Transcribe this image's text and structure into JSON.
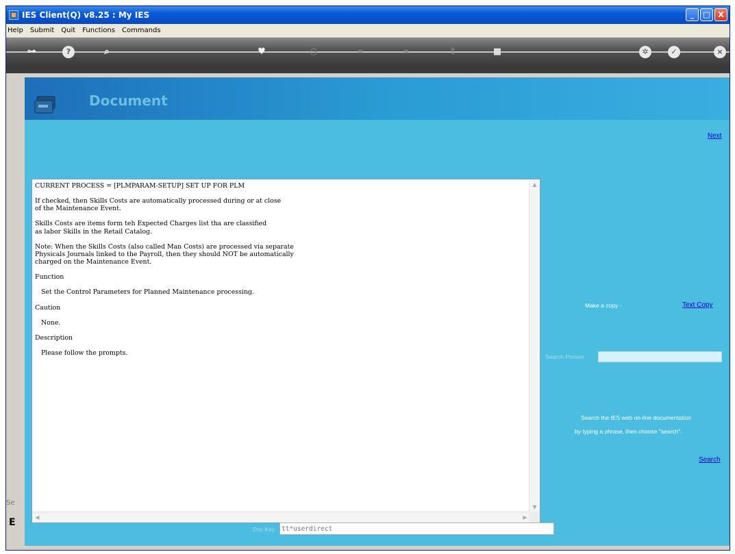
{
  "window": {
    "title": "IES Client(Q) v8.25 : My IES",
    "controls": [
      "_",
      "□",
      "X"
    ]
  },
  "menu": {
    "items": [
      "Help",
      "Submit",
      "Quit",
      "Functions",
      "Commands"
    ]
  },
  "toolbar": {
    "icons": [
      "key-icon",
      "help-icon",
      "search-icon",
      "heart-icon",
      "clock-icon",
      "rewind-icon",
      "forward-icon",
      "export-icon",
      "stop-icon",
      "gear-icon",
      "check-icon",
      "close-icon"
    ]
  },
  "panel": {
    "title": "Document",
    "next_link": "Next",
    "make_copy_label": "Make a copy -",
    "text_copy_link": "Text Copy",
    "search_phrase_label": "Search Phrase",
    "search_phrase_value": "",
    "search_help_line1": "Search the IES web on-line documentation",
    "search_help_line2": "by typing a phrase, then choose \"search\".",
    "search_link": "Search",
    "doc_key_label": "Doc Key",
    "doc_key_value": "tt*userdirect"
  },
  "document_text": "CURRENT PROCESS = [PLMPARAM-SETUP] SET UP FOR PLM\n\nIf checked, then Skills Costs are automatically processed during or at close\nof the Maintenance Event.\n\nSkills Costs are items form teh Expected Charges list tha are classified\nas labor Skills in the Retail Catalog.\n\nNote: When the Skills Costs (also called Man Costs) are processed via separate\nPhysicals Journals linked to the Payroll, then they should NOT be automatically\ncharged on the Maintenance Event.\n\nFunction\n\n   Set the Control Parameters for Planned Maintenance processing.\n\nCaution\n\n   None.\n\nDescription\n\n   Please follow the prompts.",
  "gutter": {
    "label": "Se",
    "letter": "E"
  }
}
